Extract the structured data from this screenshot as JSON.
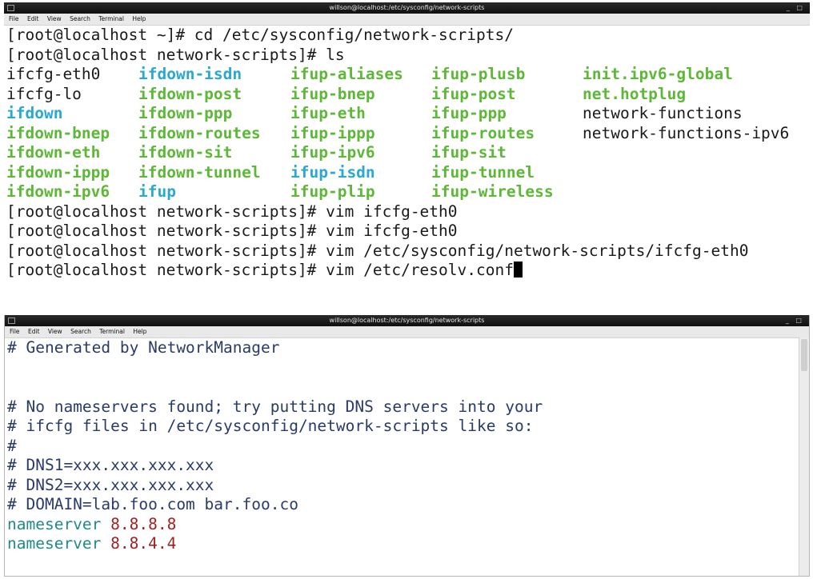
{
  "window1": {
    "title": "willson@localhost:/etc/sysconfig/network-scripts",
    "controls": "_ □",
    "menu": [
      "File",
      "Edit",
      "View",
      "Search",
      "Terminal",
      "Help"
    ],
    "lines_before": [
      "[root@localhost ~]# cd /etc/sysconfig/network-scripts/",
      "[root@localhost network-scripts]# ls"
    ],
    "ls_rows": [
      [
        {
          "t": "ifcfg-eth0",
          "c": "plain"
        },
        {
          "t": "ifdown-isdn",
          "c": "cyan"
        },
        {
          "t": "ifup-aliases",
          "c": "green"
        },
        {
          "t": "ifup-plusb",
          "c": "green"
        },
        {
          "t": "init.ipv6-global",
          "c": "green"
        }
      ],
      [
        {
          "t": "ifcfg-lo",
          "c": "plain"
        },
        {
          "t": "ifdown-post",
          "c": "green"
        },
        {
          "t": "ifup-bnep",
          "c": "green"
        },
        {
          "t": "ifup-post",
          "c": "green"
        },
        {
          "t": "net.hotplug",
          "c": "green"
        }
      ],
      [
        {
          "t": "ifdown",
          "c": "cyan"
        },
        {
          "t": "ifdown-ppp",
          "c": "green"
        },
        {
          "t": "ifup-eth",
          "c": "green"
        },
        {
          "t": "ifup-ppp",
          "c": "green"
        },
        {
          "t": "network-functions",
          "c": "plain"
        }
      ],
      [
        {
          "t": "ifdown-bnep",
          "c": "green"
        },
        {
          "t": "ifdown-routes",
          "c": "green"
        },
        {
          "t": "ifup-ippp",
          "c": "green"
        },
        {
          "t": "ifup-routes",
          "c": "green"
        },
        {
          "t": "network-functions-ipv6",
          "c": "plain"
        }
      ],
      [
        {
          "t": "ifdown-eth",
          "c": "green"
        },
        {
          "t": "ifdown-sit",
          "c": "green"
        },
        {
          "t": "ifup-ipv6",
          "c": "green"
        },
        {
          "t": "ifup-sit",
          "c": "green"
        },
        {
          "t": "",
          "c": "plain"
        }
      ],
      [
        {
          "t": "ifdown-ippp",
          "c": "green"
        },
        {
          "t": "ifdown-tunnel",
          "c": "green"
        },
        {
          "t": "ifup-isdn",
          "c": "cyan"
        },
        {
          "t": "ifup-tunnel",
          "c": "green"
        },
        {
          "t": "",
          "c": "plain"
        }
      ],
      [
        {
          "t": "ifdown-ipv6",
          "c": "green"
        },
        {
          "t": "ifup",
          "c": "cyan"
        },
        {
          "t": "ifup-plip",
          "c": "green"
        },
        {
          "t": "ifup-wireless",
          "c": "green"
        },
        {
          "t": "",
          "c": "plain"
        }
      ]
    ],
    "lines_after": [
      "[root@localhost network-scripts]# vim ifcfg-eth0",
      "[root@localhost network-scripts]# vim ifcfg-eth0",
      "[root@localhost network-scripts]# vim /etc/sysconfig/network-scripts/ifcfg-eth0"
    ],
    "current_line": "[root@localhost network-scripts]# vim /etc/resolv.conf"
  },
  "window2": {
    "title": "willson@localhost:/etc/sysconfig/network-scripts",
    "controls": "_ □",
    "menu": [
      "File",
      "Edit",
      "View",
      "Search",
      "Terminal",
      "Help"
    ],
    "comment_top": "# Generated by NetworkManager",
    "comments": [
      "# No nameservers found; try putting DNS servers into your",
      "# ifcfg files in /etc/sysconfig/network-scripts like so:",
      "#",
      "# DNS1=xxx.xxx.xxx.xxx",
      "# DNS2=xxx.xxx.xxx.xxx",
      "# DOMAIN=lab.foo.com bar.foo.co"
    ],
    "nameservers": [
      {
        "keyword": "nameserver",
        "ip": "8.8.8.8"
      },
      {
        "keyword": "nameserver",
        "ip": "8.8.4.4"
      }
    ]
  },
  "colors": {
    "green": "#5cb836",
    "cyan": "#2aa9d0",
    "comment": "#2a3b6a",
    "keyword": "#1f8a8a",
    "number": "#a32020"
  }
}
